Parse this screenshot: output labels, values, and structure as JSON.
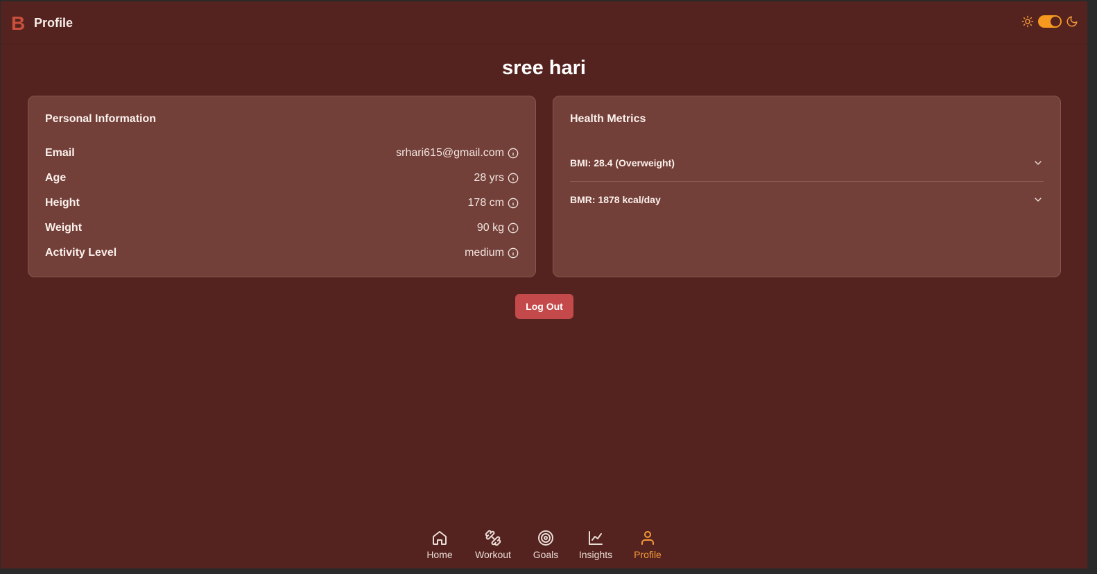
{
  "header": {
    "logo": "B",
    "title": "Profile",
    "theme_toggle_on": true
  },
  "profile": {
    "name": "sree hari"
  },
  "personal_info": {
    "title": "Personal Information",
    "rows": [
      {
        "label": "Email",
        "value": "srhari615@gmail.com"
      },
      {
        "label": "Age",
        "value": "28 yrs"
      },
      {
        "label": "Height",
        "value": "178 cm"
      },
      {
        "label": "Weight",
        "value": "90 kg"
      },
      {
        "label": "Activity Level",
        "value": "medium"
      }
    ]
  },
  "health_metrics": {
    "title": "Health Metrics",
    "items": [
      {
        "label": "BMI: 28.4 (Overweight)"
      },
      {
        "label": "BMR: 1878 kcal/day"
      }
    ]
  },
  "actions": {
    "logout_label": "Log Out"
  },
  "nav": {
    "items": [
      {
        "label": "Home",
        "icon": "home-icon"
      },
      {
        "label": "Workout",
        "icon": "dumbbell-icon"
      },
      {
        "label": "Goals",
        "icon": "target-icon"
      },
      {
        "label": "Insights",
        "icon": "chart-icon"
      },
      {
        "label": "Profile",
        "icon": "user-icon",
        "active": true
      }
    ]
  },
  "colors": {
    "background": "#55231f",
    "card": "#733f39",
    "accent": "#f59a3a",
    "logout": "#c4494a",
    "logo": "#c9503c"
  }
}
